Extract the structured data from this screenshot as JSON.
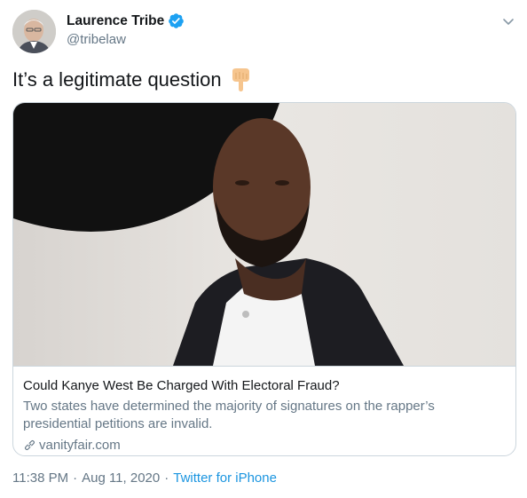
{
  "author": {
    "display_name": "Laurence Tribe",
    "handle": "@tribelaw",
    "verified": true
  },
  "tweet": {
    "text": "It’s a legitimate question",
    "emoji_icon": "backhand-index-pointing-down-icon"
  },
  "card": {
    "title": "Could Kanye West Be Charged With Electoral Fraud?",
    "description": "Two states have determined the majority of signatures on the rapper’s presidential petitions are invalid.",
    "domain": "vanityfair.com"
  },
  "meta": {
    "time": "11:38 PM",
    "separator": "·",
    "date": "Aug 11, 2020",
    "source": "Twitter for iPhone"
  },
  "colors": {
    "link_blue": "#1b95e0",
    "secondary_text": "#657786",
    "border": "#ccd6dd"
  }
}
